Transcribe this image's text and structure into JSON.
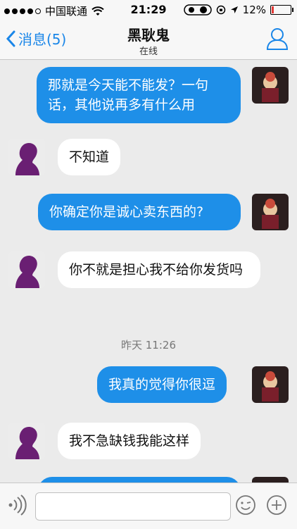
{
  "status_bar": {
    "carrier": "中国联通",
    "time": "21:29",
    "battery": "12%"
  },
  "header": {
    "back_label": "消息(5)",
    "title": "黑耿鬼",
    "subtitle": "在线"
  },
  "messages": [
    {
      "dir": "out",
      "text": "那就是今天能不能发？一句话，其他说再多有什么用"
    },
    {
      "dir": "in",
      "text": "不知道"
    },
    {
      "dir": "out",
      "text": "你确定你是诚心卖东西的?"
    },
    {
      "dir": "in",
      "text": "你不就是担心我不给你发货吗"
    },
    {
      "dir": "out",
      "text": "我真的觉得你很逗"
    },
    {
      "dir": "in",
      "text": "我不急缺钱我能这样"
    }
  ],
  "timestamp": "昨天 11:26",
  "input": {
    "placeholder": ""
  },
  "colors": {
    "accent": "#1e8fe8",
    "background": "#ebebeb"
  }
}
